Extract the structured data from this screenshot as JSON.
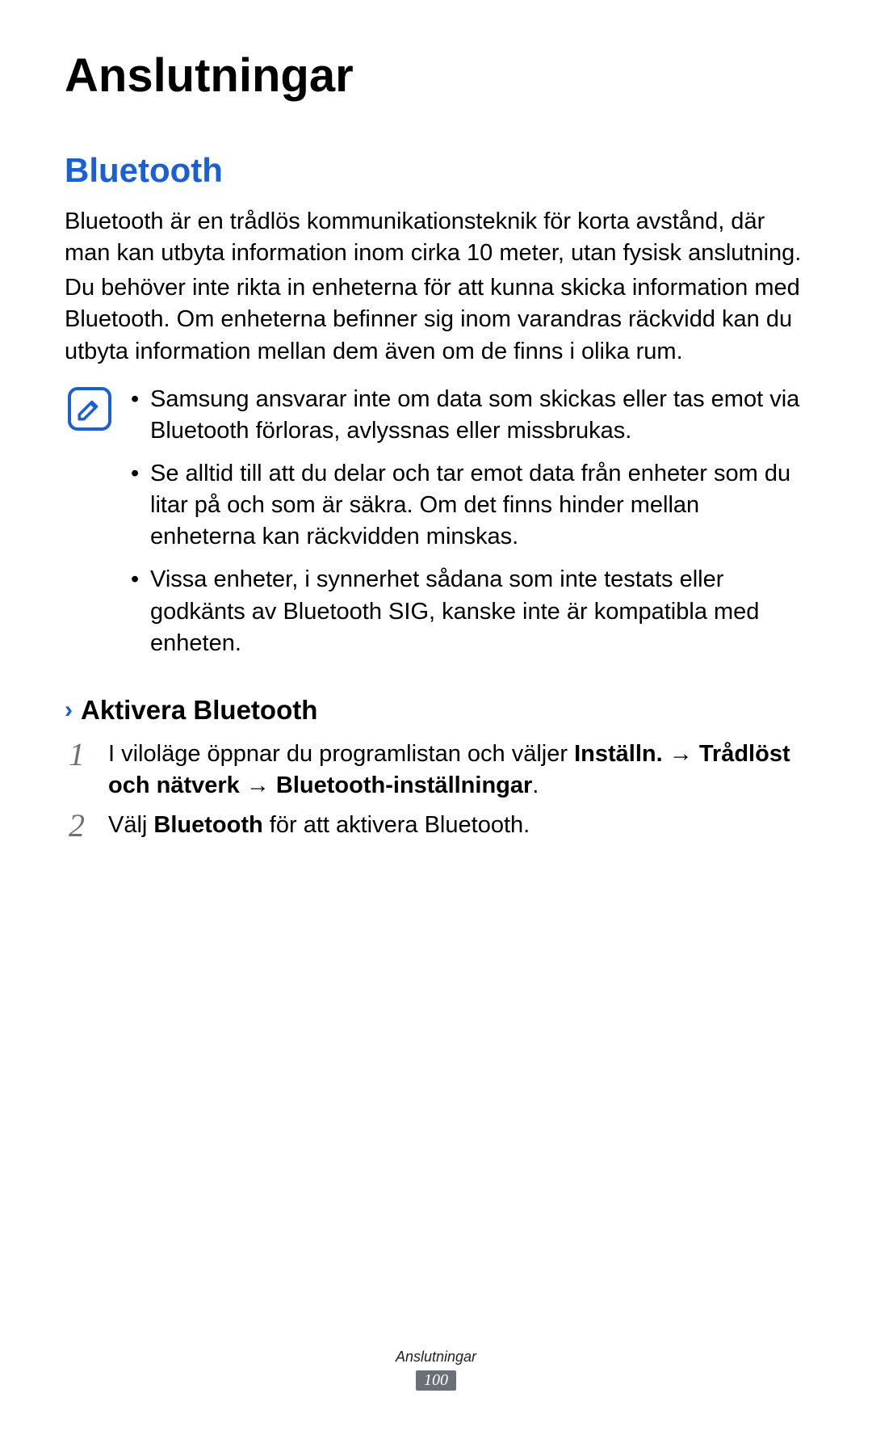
{
  "mainTitle": "Anslutningar",
  "sectionTitle": "Bluetooth",
  "para1": "Bluetooth är en trådlös kommunikationsteknik för korta avstånd, där man kan utbyta information inom cirka 10 meter, utan fysisk anslutning.",
  "para2": "Du behöver inte rikta in enheterna för att kunna skicka information med Bluetooth. Om enheterna befinner sig inom varandras räckvidd kan du utbyta information mellan dem även om de finns i olika rum.",
  "notes": [
    "Samsung ansvarar inte om data som skickas eller tas emot via Bluetooth förloras, avlyssnas eller missbrukas.",
    "Se alltid till att du delar och tar emot data från enheter som du litar på och som är säkra. Om det finns hinder mellan enheterna kan räckvidden minskas.",
    "Vissa enheter, i synnerhet sådana som inte testats eller godkänts av Bluetooth SIG, kanske inte är kompatibla med enheten."
  ],
  "subsectionTitle": "Aktivera Bluetooth",
  "step1": {
    "num": "1",
    "prefix": "I viloläge öppnar du programlistan och väljer ",
    "bold1": "Inställn.",
    "arrow1": " → ",
    "bold2": "Trådlöst och nätverk",
    "arrow2": " → ",
    "bold3": "Bluetooth-inställningar",
    "period": "."
  },
  "step2": {
    "num": "2",
    "prefix": "Välj ",
    "bold": "Bluetooth",
    "suffix": " för att aktivera Bluetooth."
  },
  "footerText": "Anslutningar",
  "pageNumber": "100"
}
